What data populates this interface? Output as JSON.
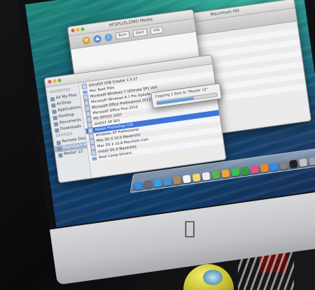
{
  "finder_back": {
    "title": "Macintosh HD"
  },
  "installer_window": {
    "title": "HFSPLUS.DMG Media",
    "buttons": [
      "Burn",
      "Eject",
      "Info"
    ]
  },
  "finder_main": {
    "sidebar": [
      "FAVORITES",
      "All My Files",
      "AirDrop",
      "Applications",
      "Desktop",
      "Documents",
      "Downloads",
      "DEVICES",
      "Remote Disc",
      "Macintosh HD",
      "Master 12"
    ],
    "files": [
      "UltraISO USB Creator 1.5.27",
      "Mac Boot Files",
      "Microsoft Windows 7 Ultimate SP1 x64",
      "Microsoft Windows 8.1 Pro Update",
      "Microsoft Office Professional 2013",
      "Microsoft Office Plus 2010",
      "MS OFFICE 2007",
      "GHOST XP SP3",
      "Adobe Photoshop CS6",
      "Windows XP Professional",
      "Mac OS X 10.9 Mavericks",
      "Mac OS X 10.8 Mountain Lion",
      "Install OS X Mavericks",
      "Boot Camp Drivers"
    ]
  },
  "copy_dialog": {
    "title": "Copying 1 item to \"Master 12\"",
    "status": "Copying",
    "progress": 0.62
  },
  "dock": {
    "icons": [
      "finder-icon",
      "launchpad-icon",
      "safari-icon",
      "mail-icon",
      "contacts-icon",
      "calendar-icon",
      "notes-icon",
      "reminders-icon",
      "maps-icon",
      "photos-icon",
      "messages-icon",
      "facetime-icon",
      "itunes-icon",
      "ibooks-icon",
      "app-store-icon",
      "preferences-icon",
      "terminal-icon",
      "disk-utility-icon",
      "trash-icon"
    ],
    "colors": [
      "#3d8be0",
      "#6a6a70",
      "#3aa0e8",
      "#4a90d8",
      "#b08a5a",
      "#f2f2f2",
      "#f5d66b",
      "#ececec",
      "#5bb44c",
      "#f2a23a",
      "#3cc04a",
      "#2f9e3d",
      "#e0508a",
      "#f08a25",
      "#2c8ff0",
      "#808489",
      "#222",
      "#c2c2c2",
      "#9aa3ad"
    ]
  },
  "device": {
    "brand_mark": "apple-logo"
  }
}
